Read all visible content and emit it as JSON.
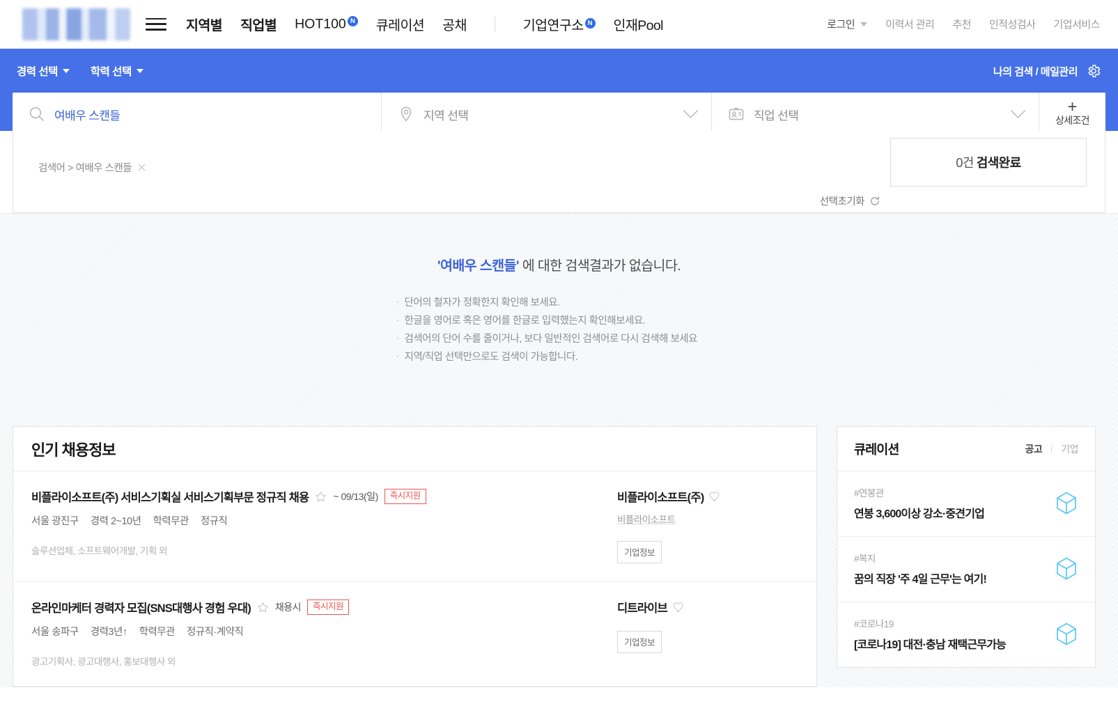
{
  "header": {
    "logo_alt": "site-logo",
    "nav": [
      {
        "label": "지역별",
        "bold": true,
        "badge": null
      },
      {
        "label": "직업별",
        "bold": true,
        "badge": null
      },
      {
        "label": "HOT100",
        "bold": false,
        "badge": "N",
        "latin": true
      },
      {
        "label": "큐레이션",
        "bold": false,
        "badge": null
      },
      {
        "label": "공채",
        "bold": false,
        "badge": null
      }
    ],
    "nav2": [
      {
        "label": "기업연구소",
        "badge": "N"
      },
      {
        "label": "인재Pool",
        "badge": null
      }
    ],
    "utility": [
      {
        "label": "로그인",
        "caret": true
      },
      {
        "label": "이력서 관리",
        "caret": false
      },
      {
        "label": "추천",
        "caret": false
      },
      {
        "label": "인적성검사",
        "caret": false
      },
      {
        "label": "기업서비스",
        "caret": false
      }
    ]
  },
  "searchbar": {
    "career_select": "경력 선택",
    "education_select": "학력 선택",
    "my_search": "나의 검색 / 메일관리",
    "keyword_value": "여배우 스캔들",
    "region_placeholder": "지역 선택",
    "job_placeholder": "직업 선택",
    "advanced_label": "상세조건",
    "advanced_plus": "+"
  },
  "summary": {
    "breadcrumb": "검색어 > 여배우 스캔들",
    "reset_label": "선택초기화",
    "result_count": "0건",
    "result_label": "검색완료"
  },
  "no_result": {
    "query": "'여배우 스캔들'",
    "title_rest": " 에 대한 검색결과가 없습니다.",
    "tips": [
      "단어의 철자가 정확한지 확인해 보세요.",
      "한글을 영어로 혹은 영어를 한글로 입력했는지 확인해보세요.",
      "검색어의 단어 수를 줄이거나, 보다 일반적인 검색어로 다시 검색해 보세요",
      "지역/직업 선택만으로도 검색이 가능합니다."
    ]
  },
  "jobs": {
    "title": "인기 채용정보",
    "items": [
      {
        "title": "비플라이소프트(주) 서비스기획실 서비스기획부문 정규직 채용",
        "deadline": "~ 09/13(일)",
        "tag": "즉시지원",
        "meta": [
          "서울 광진구",
          "경력 2~10년",
          "학력무관",
          "정규직"
        ],
        "categories": "솔루션업체, 소프트웨어개발, 기획 외",
        "company": "비플라이소프트(주)",
        "company_sub": "비플라이소프트",
        "company_button": "기업정보"
      },
      {
        "title": "온라인마케터 경력자 모집(SNS대행사 경험 우대)",
        "deadline": "채용시",
        "tag": "즉시지원",
        "meta": [
          "서울 송파구",
          "경력3년↑",
          "학력무관",
          "정규직·계약직"
        ],
        "categories": "광고기획사, 광고대행사, 홍보대행사 외",
        "company": "디트라이브",
        "company_sub": "",
        "company_button": "기업정보"
      }
    ]
  },
  "curation": {
    "title": "큐레이션",
    "tab_active": "공고",
    "tab_inactive": "기업",
    "items": [
      {
        "tag": "#연봉관",
        "title": "연봉 3,600이상 강소·중견기업"
      },
      {
        "tag": "#복지",
        "title": "꿈의 직장 '주 4일 근무'는 여기!"
      },
      {
        "tag": "#코로나19",
        "title": "[코로나19] 대전·충남 재택근무가능"
      }
    ]
  },
  "colors": {
    "brand_blue": "#4570e8",
    "link_blue": "#3b63d8",
    "tag_red": "#ef5350",
    "cube_blue": "#4ec3f7"
  }
}
